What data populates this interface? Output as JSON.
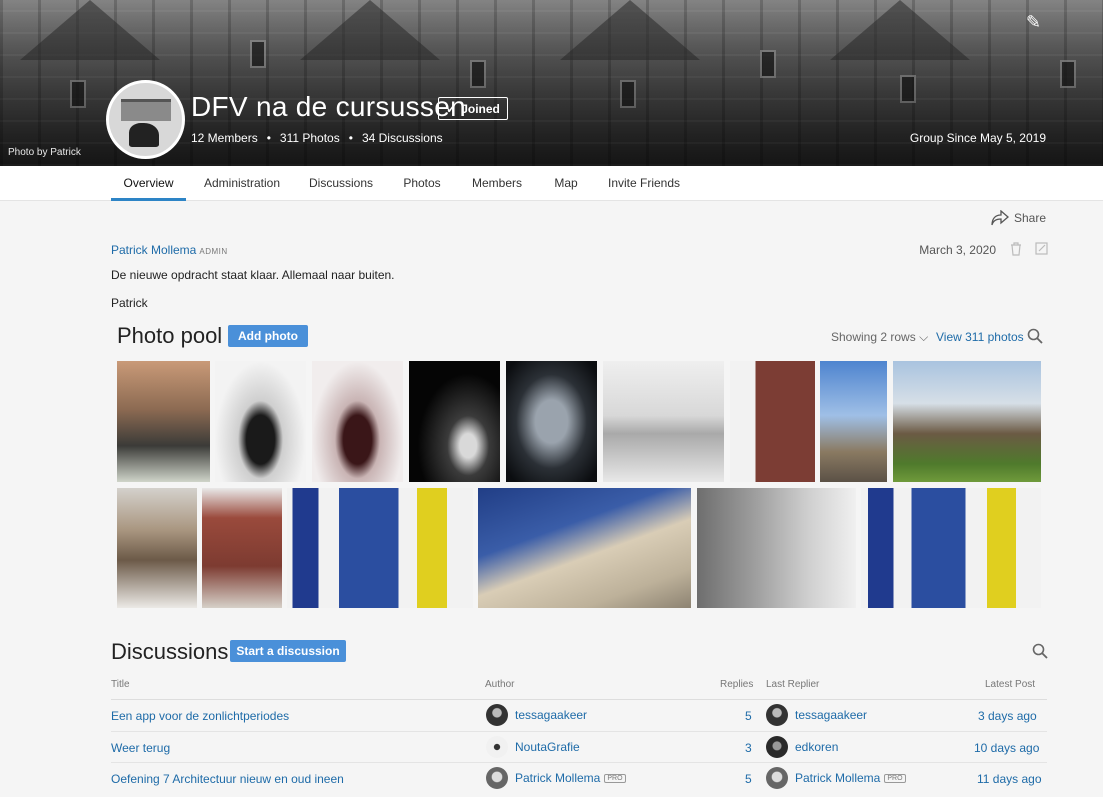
{
  "hero": {
    "title": "DFV na de cursussen",
    "joined_label": "Joined",
    "members": "12 Members",
    "photos": "311 Photos",
    "discussions": "34 Discussions",
    "separator": "•",
    "since": "Group Since May 5, 2019",
    "photo_by": "Photo by Patrick"
  },
  "tabs": [
    {
      "label": "Overview"
    },
    {
      "label": "Administration"
    },
    {
      "label": "Discussions"
    },
    {
      "label": "Photos"
    },
    {
      "label": "Members"
    },
    {
      "label": "Map"
    },
    {
      "label": "Invite Friends"
    }
  ],
  "share_label": "Share",
  "post": {
    "author": "Patrick Mollema",
    "role": "ADMIN",
    "date": "March 3, 2020",
    "text": "De nieuwe opdracht staat klaar. Allemaal naar buiten.",
    "signature": "Patrick"
  },
  "pool": {
    "title": "Photo pool",
    "add_label": "Add photo",
    "showing": "Showing 2 rows",
    "view_all": "View 311 photos"
  },
  "discussions": {
    "title": "Discussions",
    "start_label": "Start a discussion",
    "headers": {
      "title": "Title",
      "author": "Author",
      "replies": "Replies",
      "last_replier": "Last Replier",
      "latest_post": "Latest Post"
    },
    "pro_badge": "PRO",
    "rows": [
      {
        "title": "Een app voor de zonlichtperiodes",
        "author": "tessagaakeer",
        "replies": "5",
        "last_replier": "tessagaakeer",
        "latest": "3 days ago"
      },
      {
        "title": "Weer terug",
        "author": "NoutaGrafie",
        "replies": "3",
        "last_replier": "edkoren",
        "latest": "10 days ago"
      },
      {
        "title": "Oefening 7 Architectuur nieuw en oud ineen",
        "author": "Patrick Mollema",
        "replies": "5",
        "last_replier": "Patrick Mollema",
        "latest": "11 days ago"
      }
    ]
  },
  "colors": {
    "accent": "#4a90d9",
    "link": "#1e6ba8",
    "tab_active": "#2d84c6"
  }
}
